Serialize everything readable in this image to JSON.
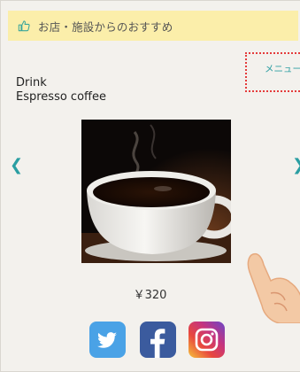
{
  "banner": {
    "text": "お店・施設からのおすすめ",
    "icon": "thumbs-up-icon"
  },
  "menu_link": {
    "label": "メニュー"
  },
  "item": {
    "category": "Drink",
    "name": "Espresso coffee",
    "price": "￥320"
  },
  "carousel": {
    "prev_icon": "chevron-left-icon",
    "next_icon": "chevron-right-icon"
  },
  "social": {
    "items": [
      {
        "name": "twitter",
        "color": "#4aa2e6"
      },
      {
        "name": "facebook",
        "color": "#3b5b9e"
      },
      {
        "name": "instagram",
        "color": "#c5347f"
      }
    ]
  },
  "colors": {
    "banner_bg": "#fbeeaa",
    "accent_teal": "#2a9ea2",
    "dotted_border": "#e43b3b",
    "page_bg": "#f3f1ed"
  }
}
